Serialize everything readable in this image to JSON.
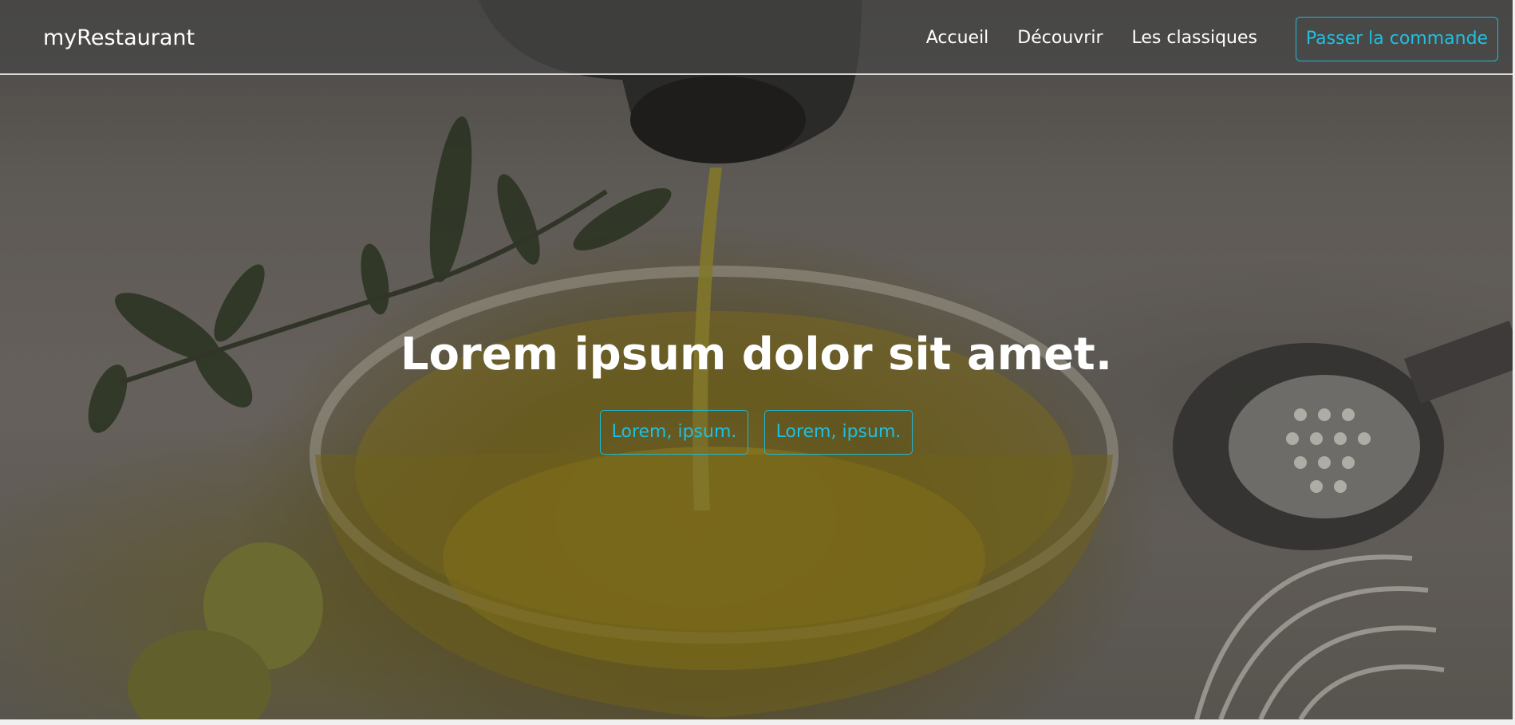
{
  "navbar": {
    "brand": "myRestaurant",
    "links": [
      "Accueil",
      "Découvrir",
      "Les classiques"
    ],
    "order_button": "Passer la commande"
  },
  "hero": {
    "title": "Lorem ipsum dolor sit amet.",
    "buttons": [
      "Lorem, ipsum.",
      "Lorem, ipsum."
    ],
    "background_image": "olive oil pouring into glass bowl"
  },
  "colors": {
    "accent": "#1fc0e0",
    "navbar_bg": "#464646",
    "text": "#ffffff"
  }
}
